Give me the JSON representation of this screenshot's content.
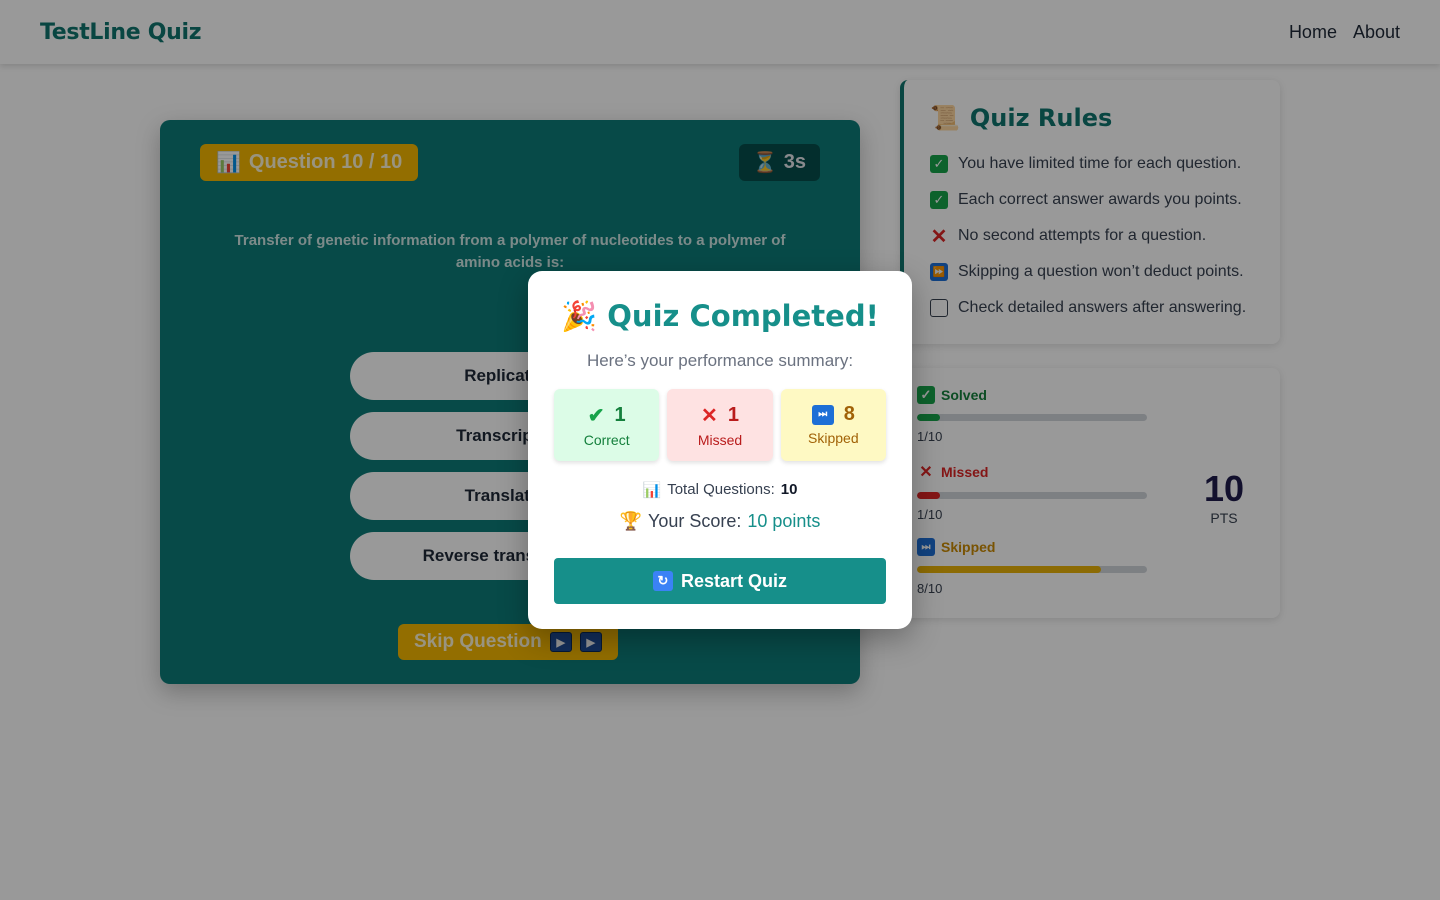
{
  "header": {
    "brand": "TestLine Quiz",
    "nav": [
      "Home",
      "About"
    ]
  },
  "quiz": {
    "question_badge": "Question 10 / 10",
    "timer": "3s",
    "question_text": "Transfer of genetic information from a polymer of nucleotides to a polymer of amino acids is:",
    "options": [
      "Replication",
      "Transcription",
      "Translation",
      "Reverse transcription"
    ],
    "skip_label": "Skip Question"
  },
  "rules": {
    "title": "Quiz Rules",
    "items": [
      "You have limited time for each question.",
      "Each correct answer awards you points.",
      "No second attempts for a question.",
      "Skipping a question won’t deduct points.",
      "Check detailed answers after answering."
    ]
  },
  "stats": {
    "solved": {
      "label": "Solved",
      "count": "1/10",
      "fraction": 0.1,
      "color": "#16a34a"
    },
    "missed": {
      "label": "Missed",
      "count": "1/10",
      "fraction": 0.1,
      "color": "#dc2626"
    },
    "skipped": {
      "label": "Skipped",
      "count": "8/10",
      "fraction": 0.8,
      "color": "#eab308"
    },
    "points": "10",
    "points_label": "PTS"
  },
  "modal": {
    "title": "Quiz Completed!",
    "subtitle": "Here’s your performance summary:",
    "correct_count": "1",
    "correct_label": "Correct",
    "missed_count": "1",
    "missed_label": "Missed",
    "skipped_count": "8",
    "skipped_label": "Skipped",
    "total_label": "Total Questions:",
    "total_value": "10",
    "score_label": "Your Score:",
    "score_value": "10 points",
    "restart_label": "Restart Quiz"
  },
  "colors": {
    "accent": "#168f8a",
    "brand": "#0f766e",
    "warning": "#f5b800"
  }
}
